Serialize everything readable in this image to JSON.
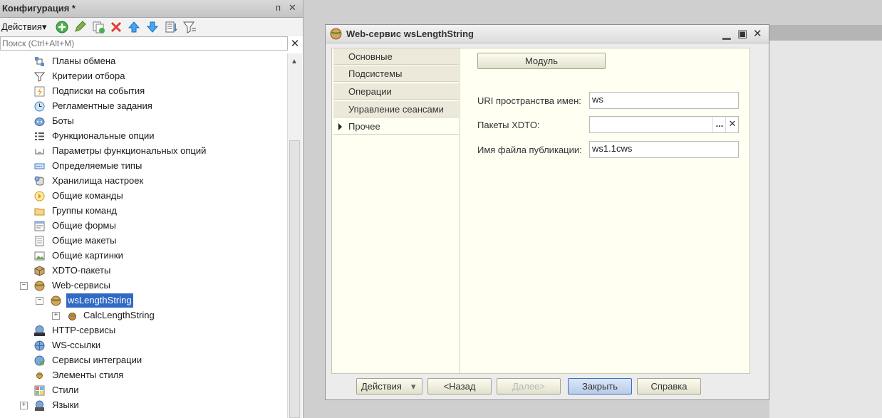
{
  "left_panel": {
    "title": "Конфигурация *",
    "pin_glyph": "ᴨ",
    "close_glyph": "✕",
    "toolbar": {
      "actions_label": "Действия",
      "actions_arrow": "▾",
      "icons": [
        "add-icon",
        "edit-icon",
        "copy-icon",
        "delete-icon",
        "move-up-icon",
        "move-down-icon",
        "sort-icon",
        "filter-icon"
      ]
    },
    "search": {
      "placeholder": "Поиск (Ctrl+Alt+M)",
      "clear_glyph": "✕"
    },
    "tree": [
      {
        "label": "Планы обмена",
        "icon": "exchange-plans-icon"
      },
      {
        "label": "Критерии отбора",
        "icon": "filter-criteria-icon"
      },
      {
        "label": "Подписки на события",
        "icon": "event-subscriptions-icon"
      },
      {
        "label": "Регламентные задания",
        "icon": "scheduled-jobs-icon"
      },
      {
        "label": "Боты",
        "icon": "bots-icon"
      },
      {
        "label": "Функциональные опции",
        "icon": "functional-options-icon"
      },
      {
        "label": "Параметры функциональных опций",
        "icon": "functional-options-params-icon"
      },
      {
        "label": "Определяемые типы",
        "icon": "defined-types-icon"
      },
      {
        "label": "Хранилища настроек",
        "icon": "settings-storage-icon"
      },
      {
        "label": "Общие команды",
        "icon": "common-commands-icon"
      },
      {
        "label": "Группы команд",
        "icon": "command-groups-icon"
      },
      {
        "label": "Общие формы",
        "icon": "common-forms-icon"
      },
      {
        "label": "Общие макеты",
        "icon": "common-templates-icon"
      },
      {
        "label": "Общие картинки",
        "icon": "common-pictures-icon"
      },
      {
        "label": "XDTO-пакеты",
        "icon": "xdto-packages-icon"
      },
      {
        "label": "Web-сервисы",
        "icon": "web-services-icon"
      },
      {
        "label": "wsLengthString",
        "icon": "web-service-icon"
      },
      {
        "label": "CalcLengthString",
        "icon": "operation-icon"
      },
      {
        "label": "HTTP-сервисы",
        "icon": "http-services-icon"
      },
      {
        "label": "WS-ссылки",
        "icon": "ws-references-icon"
      },
      {
        "label": "Сервисы интеграции",
        "icon": "integration-services-icon"
      },
      {
        "label": "Элементы стиля",
        "icon": "style-items-icon"
      },
      {
        "label": "Стили",
        "icon": "styles-icon"
      },
      {
        "label": "Языки",
        "icon": "languages-icon"
      }
    ],
    "toggle_minus": "−",
    "toggle_plus": "+"
  },
  "window": {
    "title": "Web-сервис wsLengthString",
    "minimize_glyph": "▁",
    "maximize_glyph": "▣",
    "close_glyph": "✕",
    "tabs": [
      "Основные",
      "Подсистемы",
      "Операции",
      "Управление сеансами",
      "Прочее"
    ],
    "active_tab": "Прочее",
    "module_button": "Модуль",
    "fields": {
      "uri_label": "URI пространства имен:",
      "uri_value": "ws",
      "xdto_label": "Пакеты XDTO:",
      "xdto_value": "",
      "xdto_select_glyph": "...",
      "xdto_clear_glyph": "✕",
      "file_label": "Имя файла публикации:",
      "file_value": "ws1.1cws"
    },
    "footer": {
      "actions_button": "Действия",
      "actions_arrow": "▾",
      "back_button": "<Назад",
      "next_button": "Далее>",
      "close_button": "Закрыть",
      "help_button": "Справка"
    }
  }
}
